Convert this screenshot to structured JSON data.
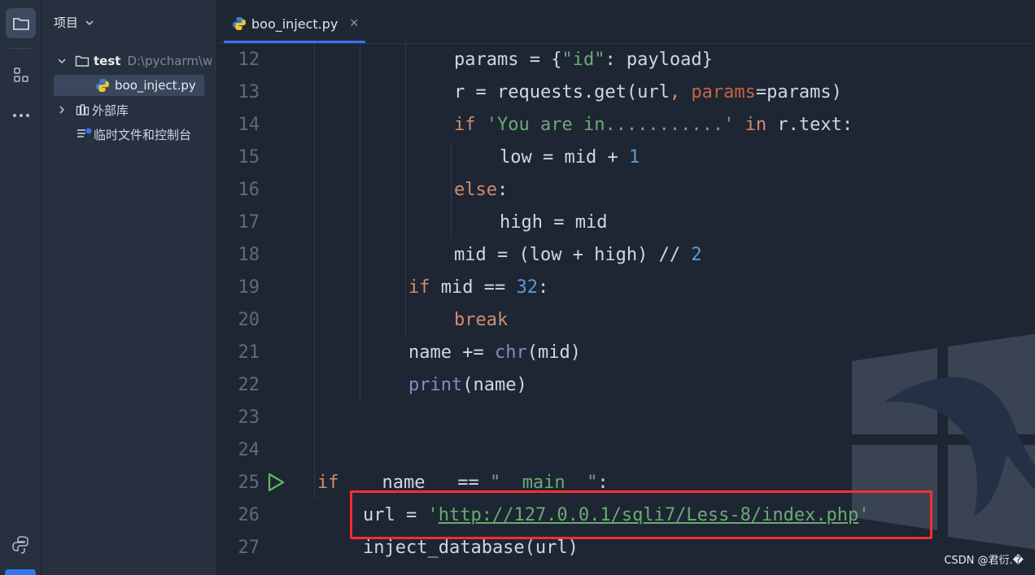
{
  "project_panel": {
    "title": "项目",
    "root_name": "test",
    "root_path": "D:\\pycharm\\w",
    "file_name": "boo_inject.py",
    "external_libs": "外部库",
    "scratches": "临时文件和控制台"
  },
  "editor": {
    "tab_label": "boo_inject.py",
    "line_numbers": [
      "12",
      "13",
      "14",
      "15",
      "16",
      "17",
      "18",
      "19",
      "20",
      "21",
      "22",
      "23",
      "24",
      "25",
      "26",
      "27"
    ]
  },
  "watermark": "CSDN @君衍.�",
  "icons": {
    "activity": [
      "folder-icon",
      "structure-icon",
      "more-icon",
      "python-console-icon"
    ],
    "tree": [
      "chevron-down-icon",
      "folder-icon",
      "python-file-icon",
      "chevron-right-icon",
      "library-icon",
      "scratch-icon"
    ],
    "gutter": [
      "run-icon"
    ]
  },
  "colors": {
    "accent": "#3574f0",
    "highlight_box": "#ff2d2d",
    "keyword": "#cf8e6d",
    "string": "#6aab73",
    "number": "#5b9bd5"
  }
}
